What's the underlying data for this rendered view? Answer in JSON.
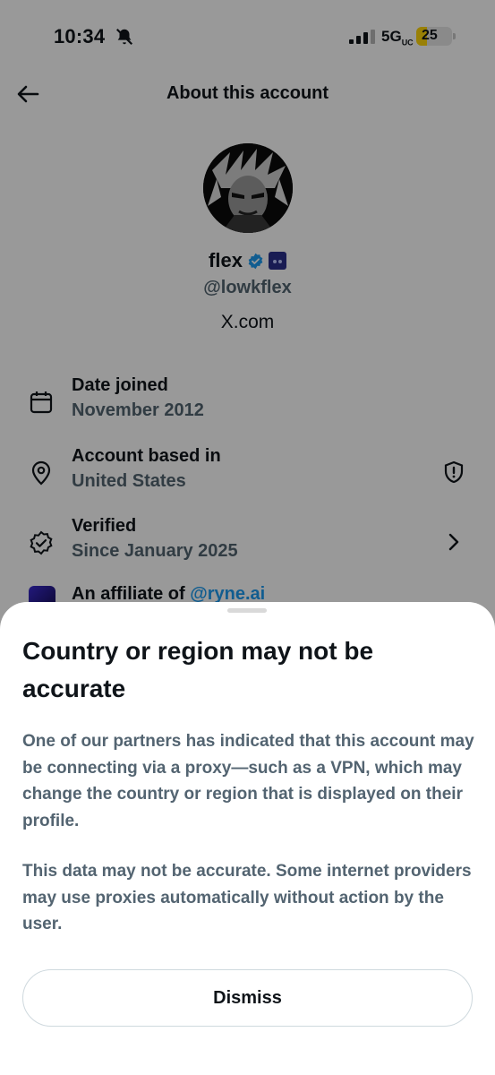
{
  "status_bar": {
    "time": "10:34",
    "network": "5G",
    "network_suffix": "UC",
    "battery": "25"
  },
  "header": {
    "title": "About this account"
  },
  "profile": {
    "name": "flex",
    "handle": "@lowkflex",
    "site": "X.com"
  },
  "info_rows": [
    {
      "label": "Date joined",
      "value": "November 2012"
    },
    {
      "label": "Account based in",
      "value": "United States"
    },
    {
      "label": "Verified",
      "value": "Since January 2025"
    },
    {
      "label": "An affiliate of ",
      "link": "@ryne.ai"
    }
  ],
  "sheet": {
    "title": "Country or region may not be accurate",
    "paragraph1": "One of our partners has indicated that this account may be connecting via a proxy—such as a VPN, which may change the country or region that is displayed on their profile.",
    "paragraph2": "This data may not be accurate. Some internet providers may use proxies automatically without action by the user.",
    "dismiss_label": "Dismiss"
  },
  "icons": {
    "back": "arrow-left-icon",
    "calendar": "calendar-icon",
    "location": "map-pin-icon",
    "verified": "verified-badge-icon",
    "shield": "shield-alert-icon",
    "chevron": "chevron-right-icon"
  },
  "colors": {
    "accent": "#1d9bf0",
    "secondary_text": "#536471",
    "battery": "#ffd60a"
  }
}
